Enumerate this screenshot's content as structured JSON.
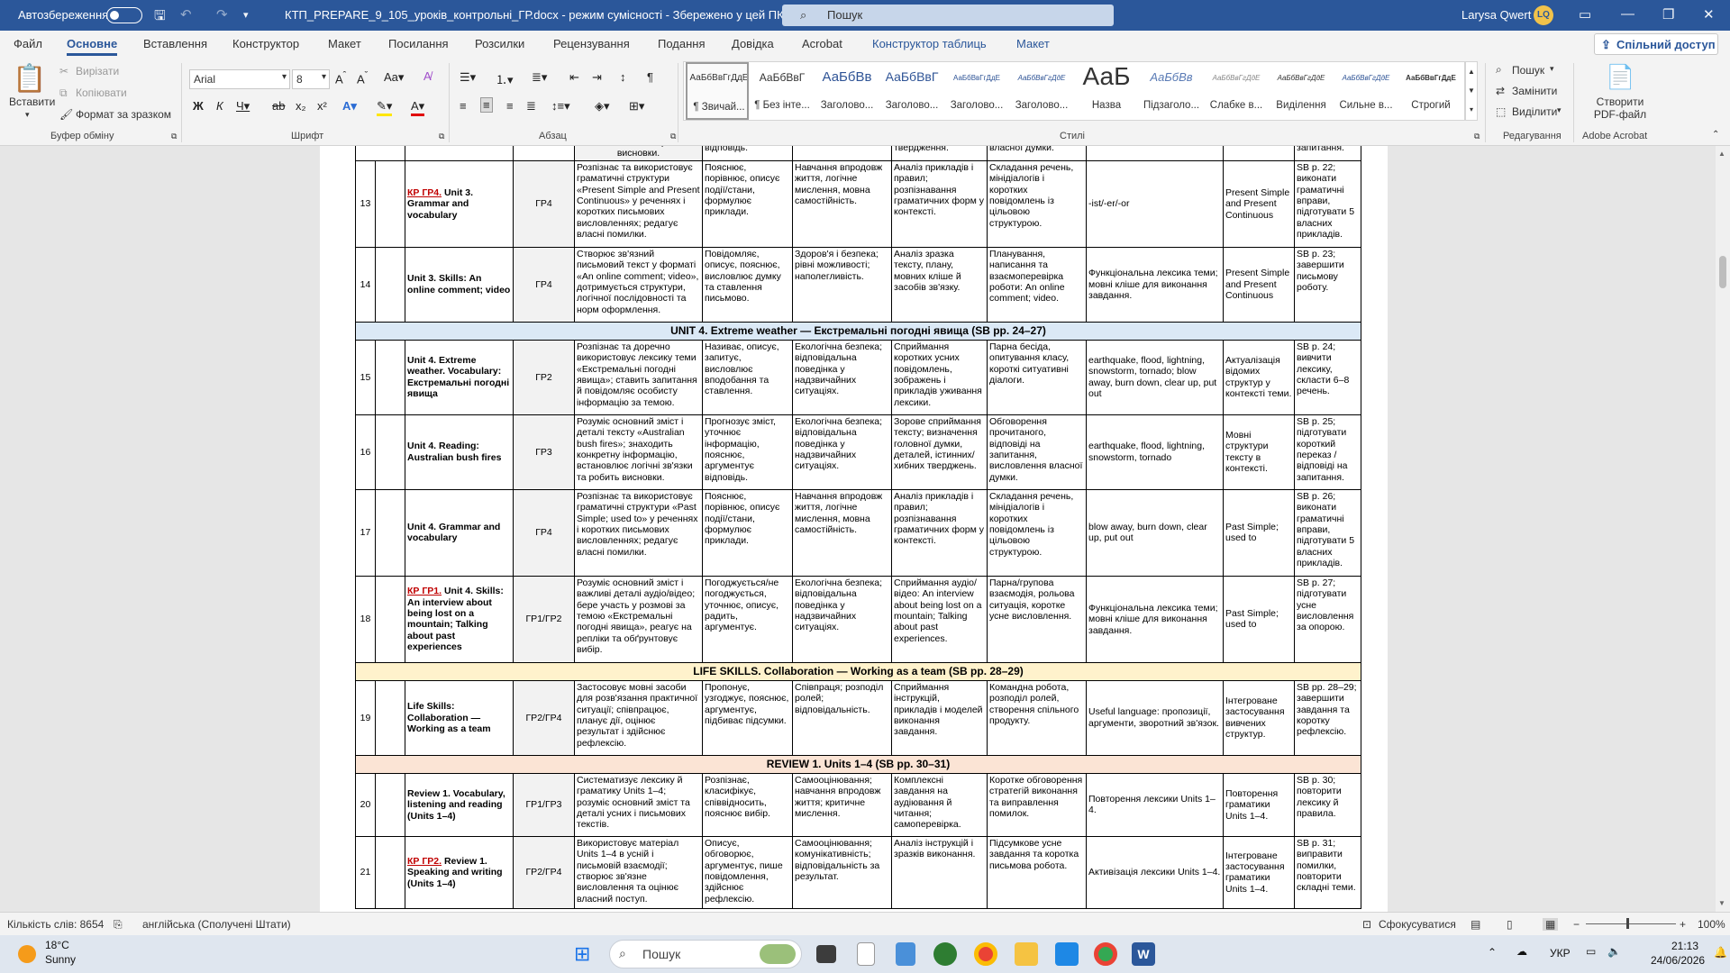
{
  "titlebar": {
    "autosave_label": "Автозбереження",
    "doc_title": "КТП_PREPARE_9_105_уроків_контрольні_ГР.docx - режим сумісності - Збережено у цей ПК",
    "search_placeholder": "Пошук",
    "user_name": "Larysa Qwert",
    "user_initials": "LQ"
  },
  "tabs": [
    "Файл",
    "Основне",
    "Вставлення",
    "Конструктор",
    "Макет",
    "Посилання",
    "Розсилки",
    "Рецензування",
    "Подання",
    "Довідка",
    "Acrobat",
    "Конструктор таблиць",
    "Макет"
  ],
  "share_label": "Спільний доступ",
  "ribbon": {
    "clipboard": {
      "paste": "Вставити",
      "cut": "Вирізати",
      "copy": "Копіювати",
      "format_painter": "Формат за зразком",
      "group": "Буфер обміну"
    },
    "font": {
      "name": "Arial",
      "size": "8",
      "group": "Шрифт"
    },
    "paragraph": {
      "group": "Абзац"
    },
    "styles": {
      "group": "Стилі",
      "items": [
        {
          "preview": "АаБбВвГгДдЕ",
          "name": "¶ Звичай..."
        },
        {
          "preview": "АаБбВвГ",
          "name": "¶ Без інте..."
        },
        {
          "preview": "АаБбВв",
          "name": "Заголово..."
        },
        {
          "preview": "АаБбВвГ",
          "name": "Заголово..."
        },
        {
          "preview": "АаБбВвГгДдЕ",
          "name": "Заголово..."
        },
        {
          "preview": "АаБбВвГгДдЕ",
          "name": "Заголово..."
        },
        {
          "preview": "АаБ",
          "name": "Назва"
        },
        {
          "preview": "АаБбВв",
          "name": "Підзаголо..."
        },
        {
          "preview": "АаБбВвГгДдЕ",
          "name": "Слабке в..."
        },
        {
          "preview": "АаБбВвГгДдЕ",
          "name": "Виділення"
        },
        {
          "preview": "АаБбВвГгДдЕ",
          "name": "Сильне в..."
        },
        {
          "preview": "АаБбВвГгДдЕ",
          "name": "Строгий"
        }
      ]
    },
    "editing": {
      "find": "Пошук",
      "replace": "Замінити",
      "select": "Виділити",
      "group": "Редагування"
    },
    "acrobat": {
      "create_pdf": "Створити PDF-файл",
      "group": "Adobe Acrobat"
    }
  },
  "table": {
    "partial_top": [
      "",
      "",
      "",
      "логічні зв'язки та робить висновки.",
      "відповідь.",
      "",
      "твердження.",
      "власної думки.",
      "",
      "",
      "запитання."
    ],
    "rows": [
      {
        "num": "13",
        "kr": "КР ГР4.",
        "topic": " Unit 3. Grammar and vocabulary",
        "gr": "ГР4",
        "outcomes": "Розпізнає та використовує граматичні структури «Present Simple and Present Continuous» у реченнях і коротких письмових висловленнях; редагує власні помилки.",
        "c5": "Пояснює, порівнює, описує події/стани, формулює приклади.",
        "c6": "Навчання впродовж життя, логічне мислення, мовна самостійність.",
        "c7": "Аналіз прикладів і правил; розпізнавання граматичних форм у контексті.",
        "c8": "Складання речень, мінідіалогів і коротких повідомлень із цільовою структурою.",
        "c9": "-ist/-er/-or",
        "c10": "Present Simple and Present Continuous",
        "c11": "SB p. 22; виконати граматичні вправи, підготувати 5 власних прикладів."
      },
      {
        "num": "14",
        "kr": "",
        "topic": "Unit 3. Skills: An online comment; video",
        "gr": "ГР4",
        "outcomes": "Створює зв'язний письмовий текст у форматі «An online comment; video», дотримується структури, логічної послідовності та норм оформлення.",
        "c5": "Повідомляє, описує, пояснює, висловлює думку та ставлення письмово.",
        "c6": "Здоров'я і безпека; рівні можливості; наполегливість.",
        "c7": "Аналіз зразка тексту, плану, мовних кліше й засобів зв'язку.",
        "c8": "Планування, написання та взаємоперевірка роботи: An online comment; video.",
        "c9": "Функціональна лексика теми; мовні кліше для виконання завдання.",
        "c10": "Present Simple and Present Continuous",
        "c11": "SB p. 23; завершити письмову роботу."
      }
    ],
    "section_unit4": "UNIT 4. Extreme weather — Екстремальні погодні явища (SB pp. 24–27)",
    "rows2": [
      {
        "num": "15",
        "kr": "",
        "topic": "Unit 4. Extreme weather. Vocabulary: Екстремальні погодні явища",
        "gr": "ГР2",
        "outcomes": "Розпізнає та доречно використовує лексику теми «Екстремальні погодні явища»; ставить запитання й повідомляє особисту інформацію за темою.",
        "c5": "Називає, описує, запитує, висловлює вподобання та ставлення.",
        "c6": "Екологічна безпека; відповідальна поведінка у надзвичайних ситуаціях.",
        "c7": "Сприймання коротких усних повідомлень, зображень і прикладів уживання лексики.",
        "c8": "Парна бесіда, опитування класу, короткі ситуативні діалоги.",
        "c9": "earthquake, flood, lightning, snowstorm, tornado; blow away, burn down, clear up, put out",
        "c10": "Актуалізація відомих структур у контексті теми.",
        "c11": "SB p. 24; вивчити лексику, скласти 6–8 речень."
      },
      {
        "num": "16",
        "kr": "",
        "topic": "Unit 4. Reading: Australian bush fires",
        "gr": "ГР3",
        "outcomes": "Розуміє основний зміст і деталі тексту «Australian bush fires»; знаходить конкретну інформацію, встановлює логічні зв'язки та робить висновки.",
        "c5": "Прогнозує зміст, уточнює інформацію, пояснює, аргументує відповідь.",
        "c6": "Екологічна безпека; відповідальна поведінка у надзвичайних ситуаціях.",
        "c7": "Зорове сприймання тексту; визначення головної думки, деталей, істинних/хибних тверджень.",
        "c8": "Обговорення прочитаного, відповіді на запитання, висловлення власної думки.",
        "c9": "earthquake, flood, lightning, snowstorm, tornado",
        "c10": "Мовні структури тексту в контексті.",
        "c11": "SB p. 25; підготувати короткий переказ / відповіді на запитання."
      },
      {
        "num": "17",
        "kr": "",
        "topic": "Unit 4. Grammar and vocabulary",
        "gr": "ГР4",
        "outcomes": "Розпізнає та використовує граматичні структури «Past Simple; used to» у реченнях і коротких письмових висловленнях; редагує власні помилки.",
        "c5": "Пояснює, порівнює, описує події/стани, формулює приклади.",
        "c6": "Навчання впродовж життя, логічне мислення, мовна самостійність.",
        "c7": "Аналіз прикладів і правил; розпізнавання граматичних форм у контексті.",
        "c8": "Складання речень, мінідіалогів і коротких повідомлень із цільовою структурою.",
        "c9": "blow away, burn down, clear up, put out",
        "c10": "Past Simple; used to",
        "c11": "SB p. 26; виконати граматичні вправи, підготувати 5 власних прикладів."
      },
      {
        "num": "18",
        "kr": "КР ГР1.",
        "topic": " Unit 4. Skills: An interview about being lost on a mountain; Talking about past experiences",
        "gr": "ГР1/ГР2",
        "outcomes": "Розуміє основний зміст і важливі деталі аудіо/відео; бере участь у розмові за темою «Екстремальні погодні явища», реагує на репліки та обґрунтовує вибір.",
        "c5": "Погоджується/не погоджується, уточнює, описує, радить, аргументує.",
        "c6": "Екологічна безпека; відповідальна поведінка у надзвичайних ситуаціях.",
        "c7": "Сприймання аудіо/відео: An interview about being lost on a mountain; Talking about past experiences.",
        "c8": "Парна/групова взаємодія, рольова ситуація, коротке усне висловлення.",
        "c9": "Функціональна лексика теми; мовні кліше для виконання завдання.",
        "c10": "Past Simple; used to",
        "c11": "SB p. 27; підготувати усне висловлення за опорою."
      }
    ],
    "section_life": "LIFE SKILLS. Collaboration — Working as a team (SB pp. 28–29)",
    "rows3": [
      {
        "num": "19",
        "kr": "",
        "topic": "Life Skills: Collaboration — Working as a team",
        "gr": "ГР2/ГР4",
        "outcomes": "Застосовує мовні засоби для розв'язання практичної ситуації; співпрацює, планує дії, оцінює результат і здійснює рефлексію.",
        "c5": "Пропонує, узгоджує, пояснює, аргументує, підбиває підсумки.",
        "c6": "Співпраця; розподіл ролей; відповідальність.",
        "c7": "Сприймання інструкцій, прикладів і моделей виконання завдання.",
        "c8": "Командна робота, розподіл ролей, створення спільного продукту.",
        "c9": "Useful language: пропозиції, аргументи, зворотний зв'язок.",
        "c10": "Інтегроване застосування вивчених структур.",
        "c11": "SB pp. 28–29; завершити завдання та коротку рефлексію."
      }
    ],
    "section_review": "REVIEW 1. Units 1–4 (SB pp. 30–31)",
    "rows4": [
      {
        "num": "20",
        "kr": "",
        "topic": "Review 1. Vocabulary, listening and reading (Units 1–4)",
        "gr": "ГР1/ГР3",
        "outcomes": "Систематизує лексику й граматику Units 1–4; розуміє основний зміст та деталі усних і письмових текстів.",
        "c5": "Розпізнає, класифікує, співвідносить, пояснює вибір.",
        "c6": "Самооцінювання; навчання впродовж життя; критичне мислення.",
        "c7": "Комплексні завдання на аудіювання й читання; самоперевірка.",
        "c8": "Коротке обговорення стратегій виконання та виправлення помилок.",
        "c9": "Повторення лексики Units 1–4.",
        "c10": "Повторення граматики Units 1–4.",
        "c11": "SB p. 30; повторити лексику й правила."
      },
      {
        "num": "21",
        "kr": "КР ГР2.",
        "topic": " Review 1. Speaking and writing (Units 1–4)",
        "gr": "ГР2/ГР4",
        "outcomes": "Використовує матеріал Units 1–4 в усній і письмовій взаємодії; створює зв'язне висловлення та оцінює власний поступ.",
        "c5": "Описує, обговорює, аргументує, пише повідомлення, здійснює рефлексію.",
        "c6": "Самооцінювання; комунікативність; відповідальність за результат.",
        "c7": "Аналіз інструкцій і зразків виконання.",
        "c8": "Підсумкове усне завдання та коротка письмова робота.",
        "c9": "Активізація лексики Units 1–4.",
        "c10": "Інтегроване застосування граматики Units 1–4.",
        "c11": "SB p. 31; виправити помилки, повторити складні теми."
      }
    ]
  },
  "status": {
    "words": "Кількість слів: 8654",
    "language": "англійська (Сполучені Штати)",
    "focus": "Сфокусуватися",
    "zoom": "100%"
  },
  "taskbar": {
    "temp": "18°C",
    "weather": "Sunny",
    "search": "Пошук",
    "lang": "УКР",
    "time": "21:13",
    "date": "24/06/2026"
  }
}
